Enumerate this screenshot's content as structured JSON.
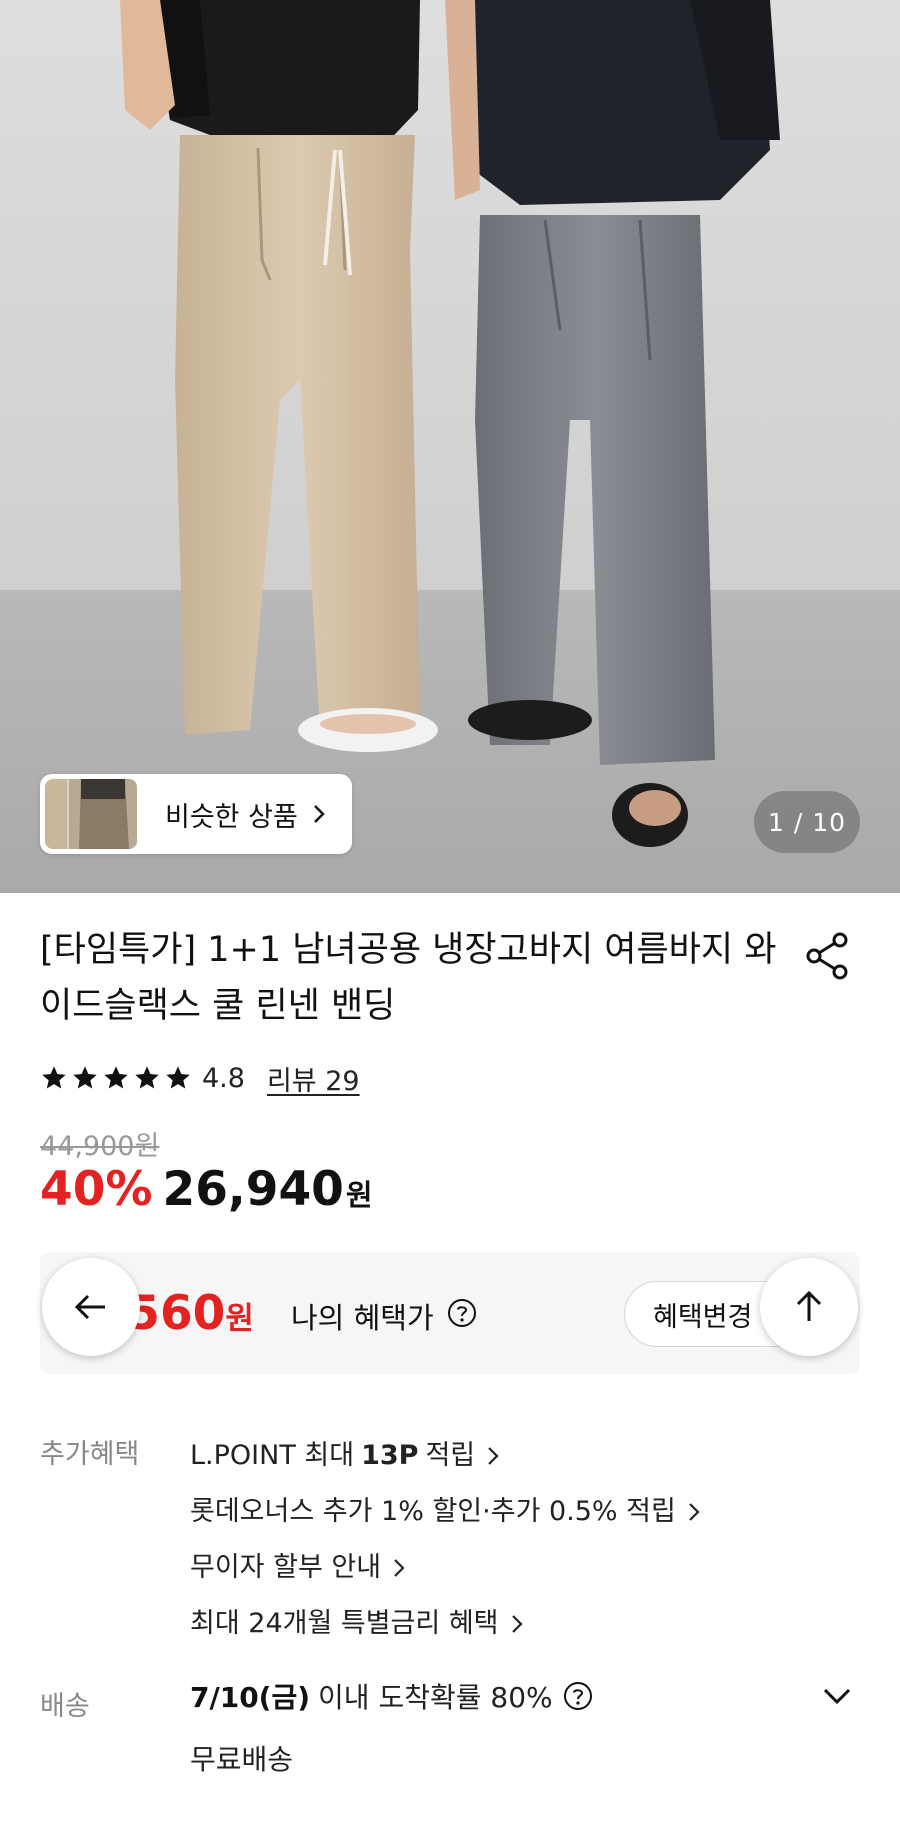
{
  "hero": {
    "similar_button_label": "비슷한 상품",
    "image_counter": "1 / 10"
  },
  "product": {
    "title": "[타임특가] 1+1 남녀공용 냉장고바지 여름바지 와이드슬랙스 쿨 린넨 밴딩",
    "rating": "4.8",
    "review_label": "리뷰 29",
    "stars": 5
  },
  "price": {
    "original": "44,900원",
    "discount": "40%",
    "sale": "26,940",
    "currency": "원"
  },
  "benefit_price": {
    "value": "2\u0000,560",
    "visible_value": "26,560",
    "currency": "원",
    "label": "나의 혜택가",
    "change_button": "혜택변경"
  },
  "extra_benefits": {
    "label": "추가혜택",
    "items": [
      {
        "prefix": "L.POINT 최대",
        "bold": "13P",
        "suffix": "적립"
      },
      {
        "prefix": "롯데오너스 추가 1% 할인·추가 0.5% 적립",
        "bold": "",
        "suffix": ""
      },
      {
        "prefix": "무이자 할부 안내",
        "bold": "",
        "suffix": ""
      },
      {
        "prefix": "최대 24개월 특별금리 혜택",
        "bold": "",
        "suffix": ""
      }
    ]
  },
  "delivery": {
    "label": "배송",
    "date": "7/10(금)",
    "text": "이내 도착확률 80%",
    "fee": "무료배송"
  },
  "colors": {
    "accent_red": "#e52222",
    "muted_gray": "#888888"
  }
}
